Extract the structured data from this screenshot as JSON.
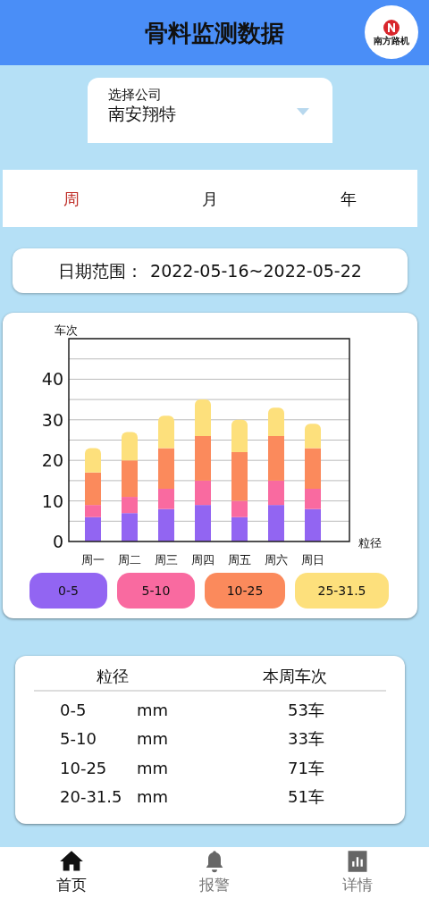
{
  "header": {
    "title": "骨料监测数据",
    "logo_text": "南方路机"
  },
  "company_select": {
    "label": "选择公司",
    "value": "南安翔特"
  },
  "period_tabs": [
    {
      "label": "周",
      "selected": true
    },
    {
      "label": "月",
      "selected": false
    },
    {
      "label": "年",
      "selected": false
    }
  ],
  "date_range": {
    "label": "日期范围：",
    "value": "2022-05-16~2022-05-22"
  },
  "chart": {
    "chart_data": {
      "type": "bar",
      "stacked": true,
      "grid": true,
      "ylabel": "车次",
      "xlabel": "粒径",
      "ylim": [
        0,
        50
      ],
      "yticks": [
        0,
        10,
        20,
        30,
        40
      ],
      "categories": [
        "周一",
        "周二",
        "周三",
        "周四",
        "周五",
        "周六",
        "周日"
      ],
      "series": [
        {
          "name": "0-5",
          "color": "#9265f2",
          "values": [
            6,
            7,
            8,
            9,
            6,
            9,
            8
          ]
        },
        {
          "name": "5-10",
          "color": "#f96aa0",
          "values": [
            3,
            4,
            5,
            6,
            4,
            6,
            5
          ]
        },
        {
          "name": "10-25",
          "color": "#fb8a5c",
          "values": [
            8,
            9,
            10,
            11,
            12,
            11,
            10
          ]
        },
        {
          "name": "25-31.5",
          "color": "#fde07c",
          "values": [
            6,
            7,
            8,
            9,
            8,
            7,
            6
          ]
        }
      ]
    }
  },
  "summary_table": {
    "columns": [
      "粒径",
      "本周车次"
    ],
    "rows": [
      {
        "size": "0-5",
        "unit": "mm",
        "count": "53车"
      },
      {
        "size": "5-10",
        "unit": "mm",
        "count": "33车"
      },
      {
        "size": "10-25",
        "unit": "mm",
        "count": "71车"
      },
      {
        "size": "20-31.5",
        "unit": "mm",
        "count": "51车"
      }
    ]
  },
  "bottom_nav": [
    {
      "label": "首页",
      "kind": "home",
      "selected": true
    },
    {
      "label": "报警",
      "kind": "bell",
      "selected": false
    },
    {
      "label": "详情",
      "kind": "chart",
      "selected": false
    }
  ]
}
